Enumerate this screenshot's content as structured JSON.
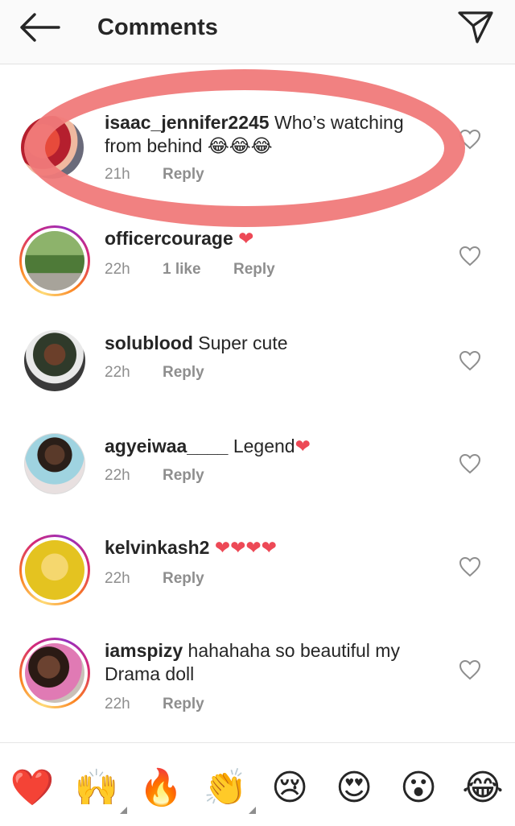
{
  "header": {
    "title": "Comments"
  },
  "comments": [
    {
      "username": "isaac_jennifer2245",
      "text": "Who’s watching from behind 😂😂😂",
      "time": "21h",
      "likes": "",
      "reply_label": "Reply",
      "avatar_ring": false
    },
    {
      "username": "officercourage",
      "text": "❤️",
      "time": "22h",
      "likes": "1 like",
      "reply_label": "Reply",
      "avatar_ring": true
    },
    {
      "username": "solublood",
      "text": "Super cute",
      "time": "22h",
      "likes": "",
      "reply_label": "Reply",
      "avatar_ring": false
    },
    {
      "username": "agyeiwaa____",
      "text": "Legend❤️",
      "time": "22h",
      "likes": "",
      "reply_label": "Reply",
      "avatar_ring": false
    },
    {
      "username": "kelvinkash2",
      "text": "❤️❤️❤️❤️",
      "time": "22h",
      "likes": "",
      "reply_label": "Reply",
      "avatar_ring": true
    },
    {
      "username": "iamspizy",
      "text": "hahahaha so beautiful my Drama doll",
      "time": "22h",
      "likes": "",
      "reply_label": "Reply",
      "avatar_ring": true
    }
  ],
  "emoji_bar": [
    "❤️",
    "🙌",
    "🔥",
    "👏",
    "😢",
    "😍",
    "😮",
    "😂"
  ],
  "colors": {
    "annotation": "#f07a7a",
    "heart": "#ed4956",
    "secondary_text": "#8e8e8e"
  }
}
